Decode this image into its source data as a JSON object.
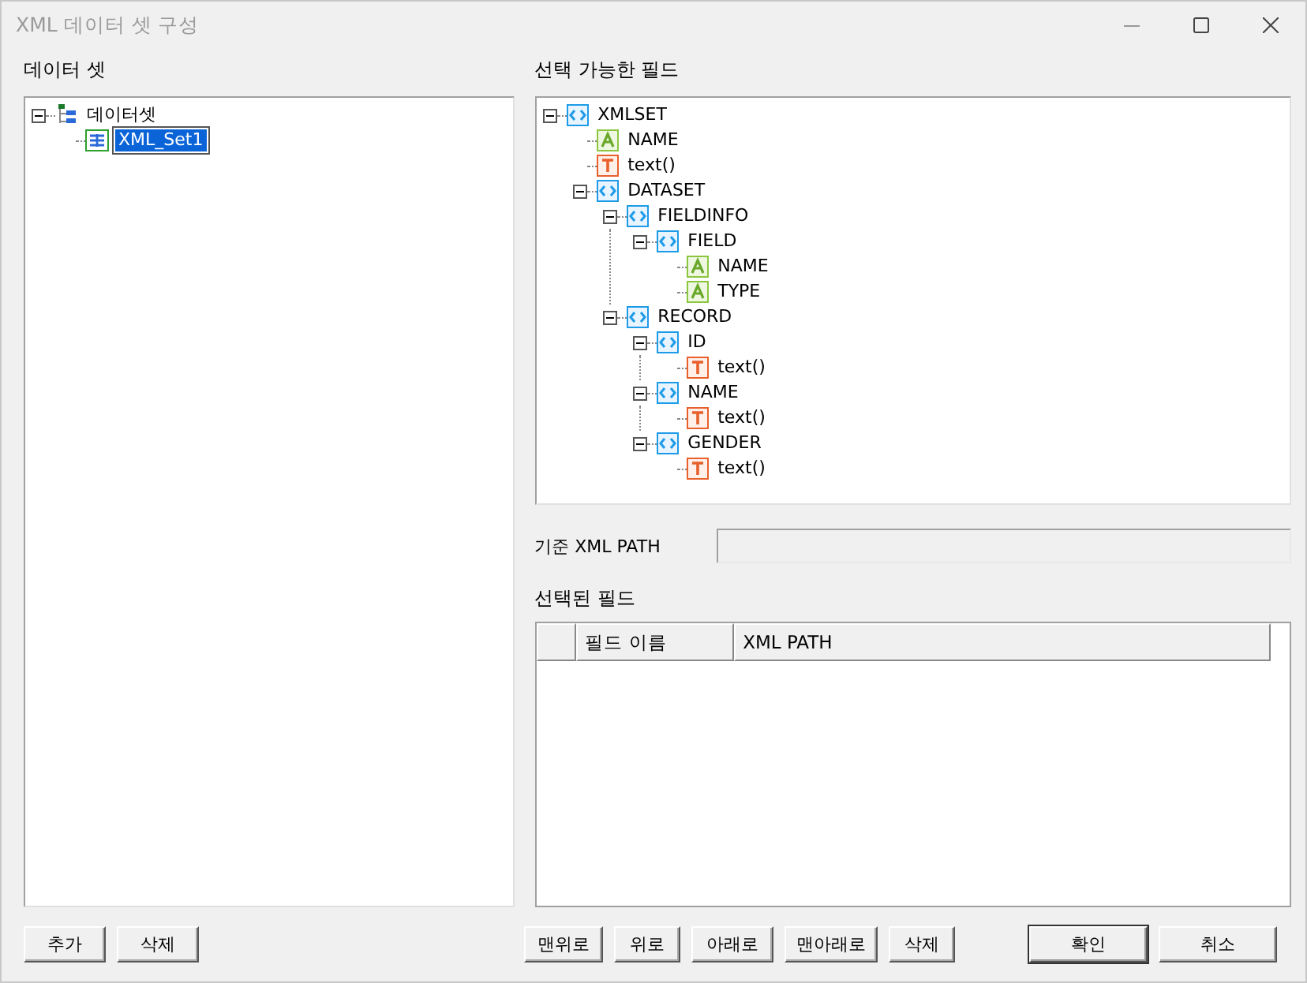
{
  "window": {
    "title": "XML 데이터 셋 구성"
  },
  "dataset_panel": {
    "label": "데이터 셋",
    "tree": [
      {
        "label": "데이터셋",
        "kind": "root",
        "expanded": true,
        "selected": false,
        "children": [
          {
            "label": "XML_Set1",
            "kind": "table",
            "selected": true
          }
        ]
      }
    ]
  },
  "fields_panel": {
    "label": "선택 가능한 필드",
    "tree": [
      {
        "label": "XMLSET",
        "kind": "element",
        "expanded": true,
        "children": [
          {
            "label": "NAME",
            "kind": "attribute"
          },
          {
            "label": "text()",
            "kind": "text"
          },
          {
            "label": "DATASET",
            "kind": "element",
            "expanded": true,
            "children": [
              {
                "label": "FIELDINFO",
                "kind": "element",
                "expanded": true,
                "children": [
                  {
                    "label": "FIELD",
                    "kind": "element",
                    "expanded": true,
                    "children": [
                      {
                        "label": "NAME",
                        "kind": "attribute"
                      },
                      {
                        "label": "TYPE",
                        "kind": "attribute"
                      }
                    ]
                  }
                ]
              },
              {
                "label": "RECORD",
                "kind": "element",
                "expanded": true,
                "children": [
                  {
                    "label": "ID",
                    "kind": "element",
                    "expanded": true,
                    "children": [
                      {
                        "label": "text()",
                        "kind": "text"
                      }
                    ]
                  },
                  {
                    "label": "NAME",
                    "kind": "element",
                    "expanded": true,
                    "children": [
                      {
                        "label": "text()",
                        "kind": "text"
                      }
                    ]
                  },
                  {
                    "label": "GENDER",
                    "kind": "element",
                    "expanded": true,
                    "children": [
                      {
                        "label": "text()",
                        "kind": "text"
                      }
                    ]
                  }
                ]
              }
            ]
          }
        ]
      }
    ]
  },
  "base_path": {
    "label": "기준 XML PATH"
  },
  "selected_fields": {
    "label": "선택된 필드",
    "columns": [
      "필드 이름",
      "XML PATH"
    ]
  },
  "dataset_buttons": [
    "추가",
    "삭제"
  ],
  "order_buttons": [
    "맨위로",
    "위로",
    "아래로",
    "맨아래로",
    "삭제"
  ],
  "dialog_buttons": [
    {
      "label": "확인",
      "default": true
    },
    {
      "label": "취소",
      "default": false
    }
  ]
}
